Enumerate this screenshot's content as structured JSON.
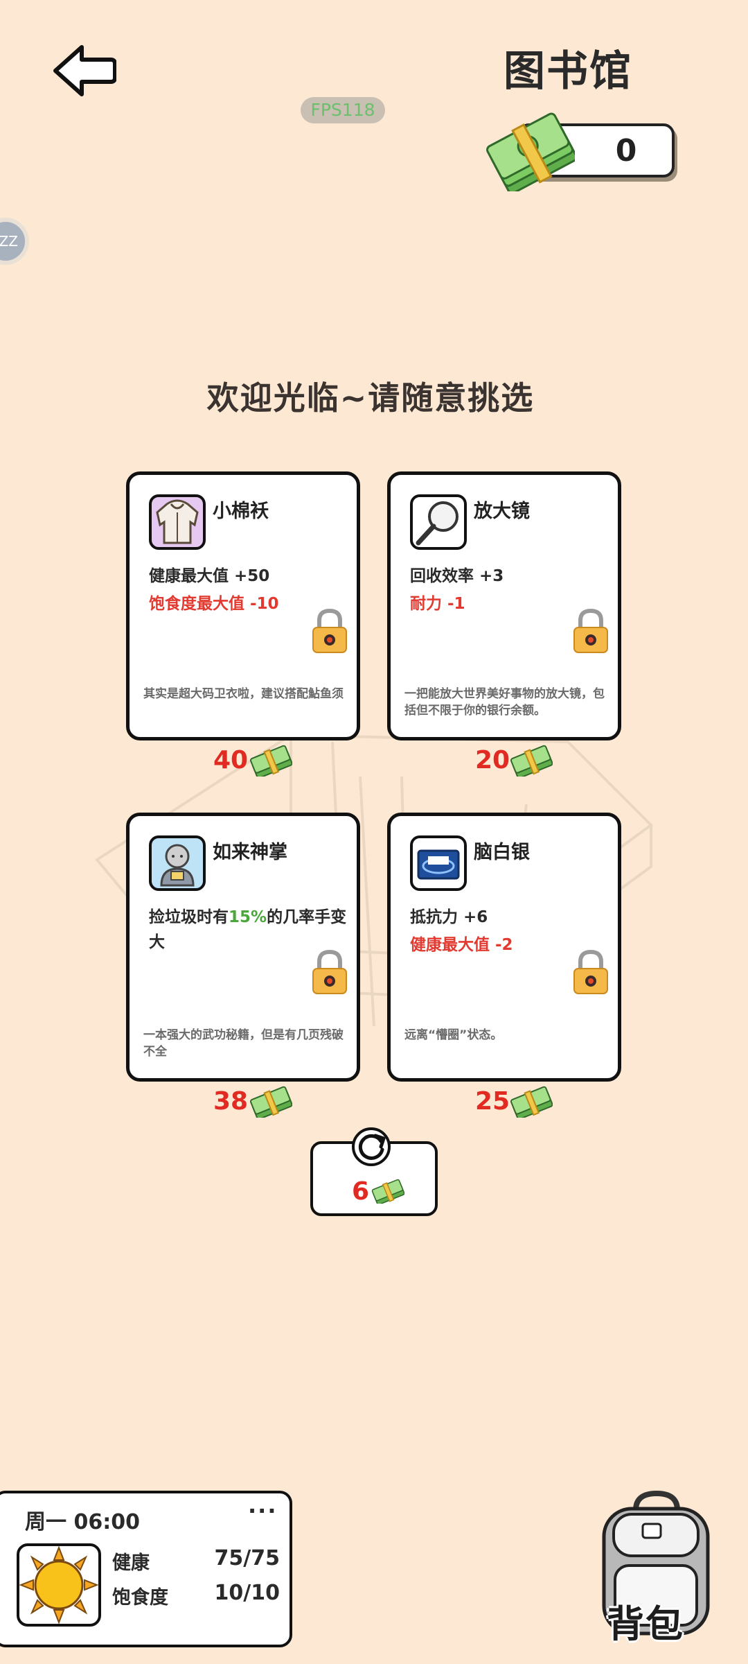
{
  "header": {
    "title": "图书馆",
    "fps": "FPS118",
    "money": "0",
    "side_bubble": "ZZ"
  },
  "welcome": "欢迎光临~请随意挑选",
  "cards": [
    {
      "name": "小棉袄",
      "effect1": "健康最大值 +50",
      "effect2": "饱食度最大值 -10",
      "desc": "其实是超大码卫衣啦，建议搭配鮎鱼须",
      "price": "40",
      "icon": "hoodie-icon"
    },
    {
      "name": "放大镜",
      "effect1": "回收效率 +3",
      "effect2": "耐力 -1",
      "desc": "一把能放大世界美好事物的放大镜，包括但不限于你的银行余额。",
      "price": "20",
      "icon": "magnifier-icon"
    },
    {
      "name": "如来神掌",
      "effect1_pre": "捡垃圾时有",
      "effect1_hl": "15%",
      "effect1_post": "的几率手变大",
      "desc": "一本强大的武功秘籍，但是有几页残破不全",
      "price": "38",
      "icon": "buddha-book-icon"
    },
    {
      "name": "脑白银",
      "effect1": "抵抗力 +6",
      "effect2": "健康最大值 -2",
      "desc": "远离“懵圈”状态。",
      "price": "25",
      "icon": "supplement-box-icon"
    }
  ],
  "refresh": {
    "cost": "6"
  },
  "status": {
    "time": "周一 06:00",
    "more": "···",
    "health_label": "健康",
    "health_value": "75/75",
    "satiety_label": "饱食度",
    "satiety_value": "10/10",
    "weather_icon": "sun-icon"
  },
  "backpack": {
    "label": "背包"
  },
  "colors": {
    "background": "#fde9d3",
    "negative": "#e23a30",
    "positive": "#4aa83a",
    "price": "#e02a22"
  }
}
